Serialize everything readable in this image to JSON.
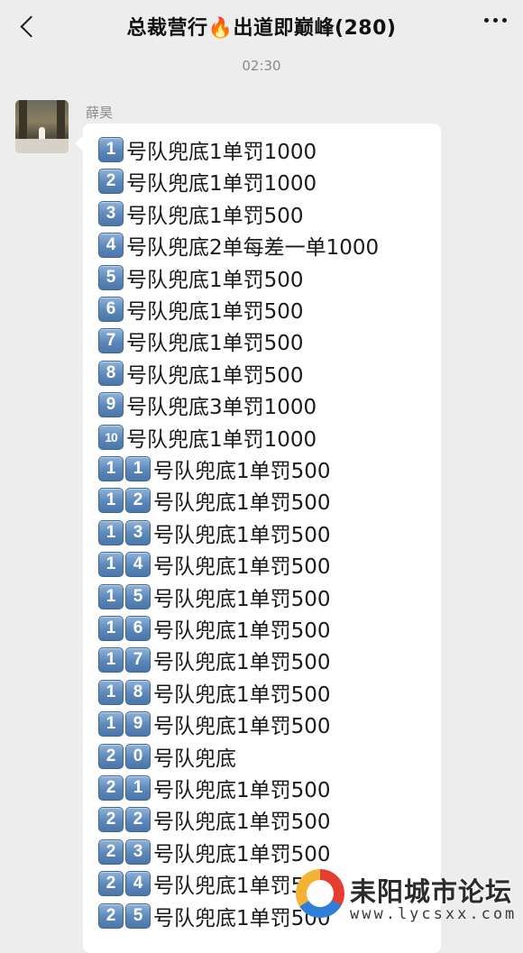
{
  "header": {
    "title_prefix": "总裁营行",
    "title_emoji": "🔥",
    "title_suffix": "出道即巅峰(280)"
  },
  "time": "02:30",
  "message": {
    "sender": "薛昊",
    "lines": [
      {
        "num": [
          "1"
        ],
        "text": "号队兜底1单罚1000"
      },
      {
        "num": [
          "2"
        ],
        "text": "号队兜底1单罚1000"
      },
      {
        "num": [
          "3"
        ],
        "text": "号队兜底1单罚500"
      },
      {
        "num": [
          "4"
        ],
        "text": "号队兜底2单每差一单1000"
      },
      {
        "num": [
          "5"
        ],
        "text": "号队兜底1单罚500"
      },
      {
        "num": [
          "6"
        ],
        "text": "号队兜底1单罚500"
      },
      {
        "num": [
          "7"
        ],
        "text": "号队兜底1单罚500"
      },
      {
        "num": [
          "8"
        ],
        "text": "号队兜底1单罚500"
      },
      {
        "num": [
          "9"
        ],
        "text": "号队兜底3单罚1000"
      },
      {
        "num": [
          "10"
        ],
        "text": "号队兜底1单罚1000"
      },
      {
        "num": [
          "1",
          "1"
        ],
        "text": "号队兜底1单罚500"
      },
      {
        "num": [
          "1",
          "2"
        ],
        "text": "号队兜底1单罚500"
      },
      {
        "num": [
          "1",
          "3"
        ],
        "text": "号队兜底1单罚500"
      },
      {
        "num": [
          "1",
          "4"
        ],
        "text": "号队兜底1单罚500"
      },
      {
        "num": [
          "1",
          "5"
        ],
        "text": "号队兜底1单罚500"
      },
      {
        "num": [
          "1",
          "6"
        ],
        "text": "号队兜底1单罚500"
      },
      {
        "num": [
          "1",
          "7"
        ],
        "text": "号队兜底1单罚500"
      },
      {
        "num": [
          "1",
          "8"
        ],
        "text": "号队兜底1单罚500"
      },
      {
        "num": [
          "1",
          "9"
        ],
        "text": "号队兜底1单罚500"
      },
      {
        "num": [
          "2",
          "0"
        ],
        "text": "号队兜底"
      },
      {
        "num": [
          "2",
          "1"
        ],
        "text": "号队兜底1单罚500"
      },
      {
        "num": [
          "2",
          "2"
        ],
        "text": "号队兜底1单罚500"
      },
      {
        "num": [
          "2",
          "3"
        ],
        "text": "号队兜底1单罚500"
      },
      {
        "num": [
          "2",
          "4"
        ],
        "text": "号队兜底1单罚500"
      },
      {
        "num": [
          "2",
          "5"
        ],
        "text": "号队兜底1单罚500"
      }
    ]
  },
  "watermark": {
    "name": "耒阳城市论坛",
    "url": "www.lycsxx.com"
  },
  "colors": {
    "background": "#ededed",
    "bubble": "#ffffff",
    "keycap": "#5b87ba"
  }
}
